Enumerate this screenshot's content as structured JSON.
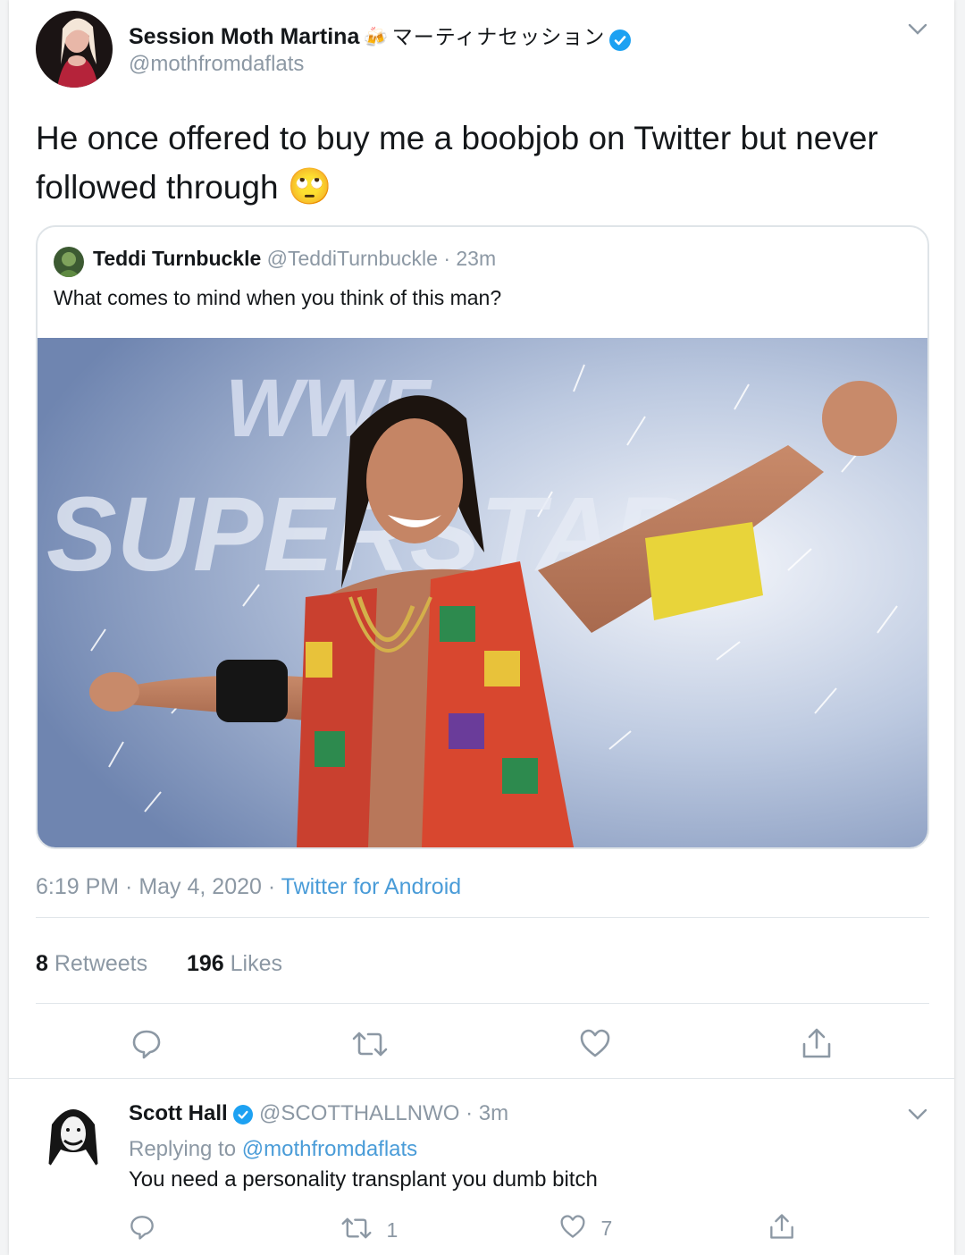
{
  "main_tweet": {
    "display_name": "Session Moth Martina",
    "name_emoji": "🍻",
    "japanese_name": "マーティナセッション",
    "handle": "@mothfromdaflats",
    "text": "He once offered to buy me a boobjob on Twitter but never followed through",
    "text_emoji": "🙄",
    "timestamp": "6:19 PM · May 4, 2020 · ",
    "client": "Twitter for Android",
    "retweets_count": "8",
    "retweets_label": "Retweets",
    "likes_count": "196",
    "likes_label": "Likes"
  },
  "quoted_tweet": {
    "display_name": "Teddi Turnbuckle",
    "handle": "@TeddiTurnbuckle",
    "time": "· 23m",
    "text": "What comes to mind when you think of this man?",
    "image_text_logo": "WWF",
    "image_text_banner": "SUPERSTARS"
  },
  "reply_tweet": {
    "display_name": "Scott Hall",
    "handle": "@SCOTTHALLNWO",
    "time": "· 3m",
    "replying_prefix": "Replying to ",
    "replying_to": "@mothfromdaflats",
    "text": "You need a personality transplant you dumb bitch",
    "retweet_count": "1",
    "like_count": "7"
  },
  "icons": [
    "chevron-down-icon",
    "verified-badge-icon",
    "reply-icon",
    "retweet-icon",
    "like-icon",
    "share-icon"
  ],
  "colors": {
    "link": "#4a9cd8",
    "verified": "#1da1f2",
    "muted": "#8c98a4"
  }
}
